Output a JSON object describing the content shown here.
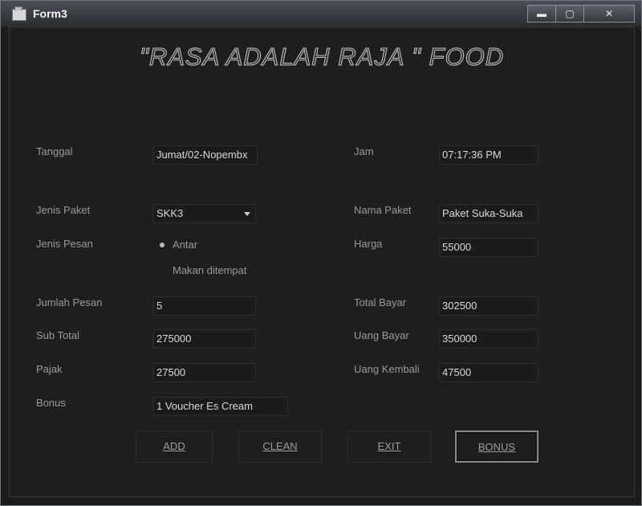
{
  "window": {
    "title": "Form3",
    "minimize_glyph": "▬",
    "maximize_glyph": "▢",
    "close_glyph": "✕"
  },
  "heading": "\"RASA ADALAH RAJA \" FOOD",
  "fields": {
    "tanggal": {
      "label": "Tanggal",
      "value": "Jumat/02-Nopembx"
    },
    "jam": {
      "label": "Jam",
      "value": "07:17:36 PM"
    },
    "jenis_paket": {
      "label": "Jenis Paket",
      "value": "SKK3"
    },
    "nama_paket": {
      "label": "Nama Paket",
      "value": "Paket Suka-Suka"
    },
    "jenis_pesan": {
      "label": "Jenis Pesan",
      "options": [
        "Antar",
        "Makan ditempat"
      ],
      "selected": "Antar"
    },
    "harga": {
      "label": "Harga",
      "value": "55000"
    },
    "jumlah_pesan": {
      "label": "Jumlah Pesan",
      "value": "5"
    },
    "total_bayar": {
      "label": "Total Bayar",
      "value": "302500"
    },
    "sub_total": {
      "label": "Sub Total",
      "value": "275000"
    },
    "uang_bayar": {
      "label": "Uang Bayar",
      "value": "350000"
    },
    "pajak": {
      "label": "Pajak",
      "value": "27500"
    },
    "uang_kembali": {
      "label": "Uang Kembali",
      "value": "47500"
    },
    "bonus": {
      "label": "Bonus",
      "value": "1 Voucher Es Cream"
    }
  },
  "buttons": {
    "add": "ADD",
    "clean": "CLEAN",
    "exit": "EXIT",
    "bonus": "BONUS"
  }
}
